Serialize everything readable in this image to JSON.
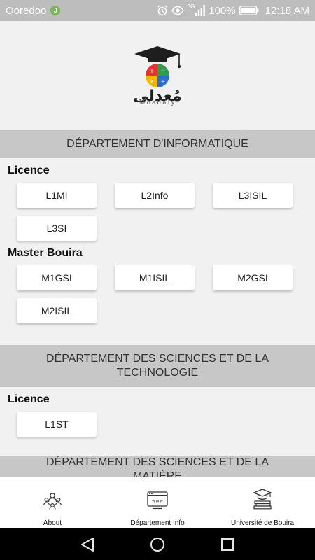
{
  "status_bar": {
    "carrier": "Ooredoo",
    "carrier_badge": "J",
    "network": "3G",
    "battery": "100%",
    "time": "12:18 AM",
    "icons": [
      "alarm-icon",
      "eye-icon",
      "signal-icon",
      "battery-icon"
    ]
  },
  "logo": {
    "arabic_text": "مُعدلي",
    "caption": "Moadaly"
  },
  "departments": [
    {
      "title": "DÉPARTEMENT D'INFORMATIQUE",
      "groups": [
        {
          "title": "Licence",
          "buttons": [
            "L1MI",
            "L2Info",
            "L3ISIL",
            "L3SI"
          ]
        },
        {
          "title": "Master Bouira",
          "buttons": [
            "M1GSI",
            "M1ISIL",
            "M2GSI",
            "M2ISIL"
          ]
        }
      ]
    },
    {
      "title": "DÉPARTEMENT DES SCIENCES ET DE LA TECHNOLOGIE",
      "groups": [
        {
          "title": "Licence",
          "buttons": [
            "L1ST"
          ]
        }
      ]
    },
    {
      "title": "DÉPARTEMENT DES SCIENCES ET DE LA MATIÈRE",
      "groups": []
    }
  ],
  "bottom_nav": [
    {
      "label": "About",
      "icon": "team-icon"
    },
    {
      "label": "Département Info",
      "icon": "website-icon"
    },
    {
      "label": "Université de Bouira",
      "icon": "graduation-books-icon"
    }
  ],
  "system_nav": [
    "back-icon",
    "home-icon",
    "recents-icon"
  ],
  "colors": {
    "status_bar": "#bdbdbd",
    "page_background": "#f1f1f1",
    "section_header": "#c7c7c7",
    "button_background": "#ffffff",
    "logo_red": "#e3342f",
    "logo_green": "#2e9c4a",
    "logo_yellow": "#f2b705",
    "logo_blue": "#2a6fcb"
  }
}
